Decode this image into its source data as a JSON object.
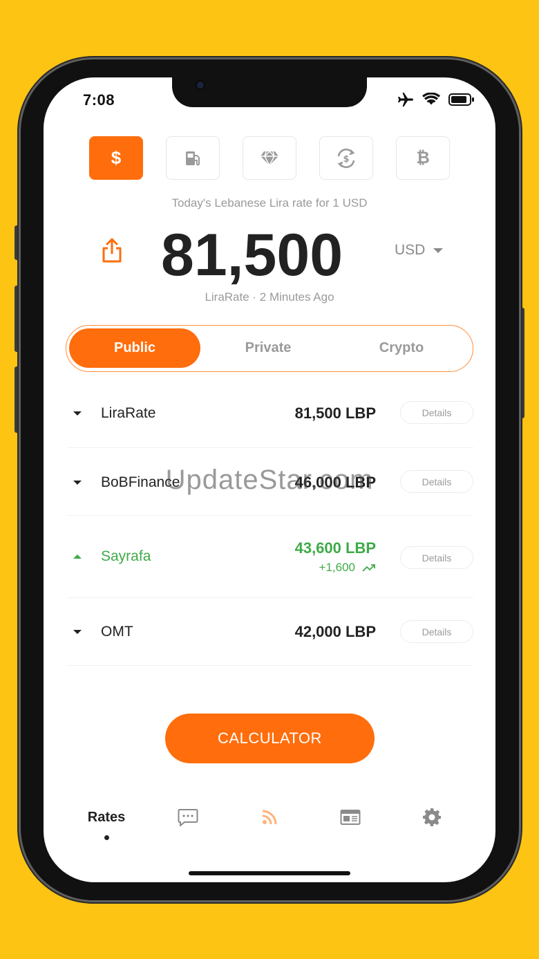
{
  "status_bar": {
    "time": "7:08"
  },
  "currency_tabs": [
    {
      "icon": "dollar-icon",
      "glyph": "$",
      "active": true
    },
    {
      "icon": "fuel-pump-icon",
      "active": false
    },
    {
      "icon": "diamond-icon",
      "active": false
    },
    {
      "icon": "exchange-icon",
      "active": false
    },
    {
      "icon": "bitcoin-icon",
      "glyph": "₿",
      "active": false
    }
  ],
  "header": {
    "caption": "Today's Lebanese Lira rate for 1 USD",
    "rate": "81,500",
    "currency": "USD",
    "source_time": "LiraRate · 2 Minutes Ago"
  },
  "market_tabs": [
    {
      "label": "Public",
      "active": true
    },
    {
      "label": "Private",
      "active": false
    },
    {
      "label": "Crypto",
      "active": false
    }
  ],
  "rates": [
    {
      "name": "LiraRate",
      "value": "81,500 LBP",
      "trend": "down",
      "details": "Details"
    },
    {
      "name": "BoBFinance",
      "value": "46,000 LBP",
      "trend": "down",
      "details": "Details"
    },
    {
      "name": "Sayrafa",
      "value": "43,600 LBP",
      "change": "+1,600",
      "trend": "up",
      "details": "Details"
    },
    {
      "name": "OMT",
      "value": "42,000 LBP",
      "trend": "down",
      "details": "Details"
    }
  ],
  "watermark": "UpdateStar.com",
  "calculator_label": "CALCULATOR",
  "bottom_nav": {
    "rates_label": "Rates",
    "items": [
      "rates",
      "chat-icon",
      "feed-icon",
      "news-icon",
      "gear-icon"
    ]
  },
  "colors": {
    "accent": "#FF6D0C",
    "positive": "#3faa48",
    "background": "#FDC413"
  }
}
